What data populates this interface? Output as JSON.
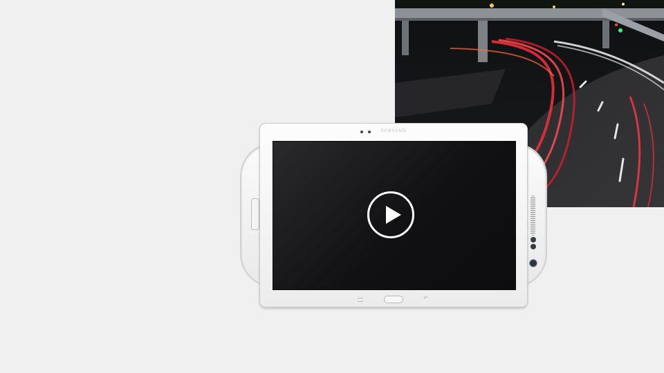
{
  "photo": {
    "alt": "",
    "colors": {
      "sky": "#111114",
      "road": "#2a2a2c",
      "light_trail_red": "#e8303a",
      "light_trail_white": "#f2f2f2",
      "bridge": "#8d9297"
    }
  },
  "tablet": {
    "brand": "SAMSUNG",
    "screen_color": "#111113",
    "play_icon": "play-icon",
    "nav": {
      "menu_icon": "menu-icon",
      "home_icon": "home-key-icon",
      "back_icon": "back-icon",
      "back_glyph": "↶"
    }
  },
  "phone": {
    "home_icon": "home-key-icon",
    "speaker_icon": "speaker-grill-icon",
    "camera_icon": "camera-icon"
  },
  "colors": {
    "background": "#f0f0f0",
    "device_white": "#f6f6f6",
    "play_white": "#ffffff"
  }
}
